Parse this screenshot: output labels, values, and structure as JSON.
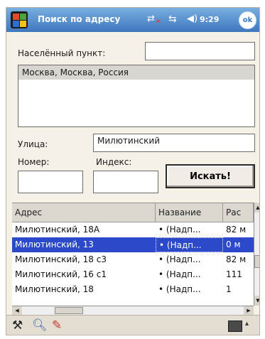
{
  "window": {
    "title": "Поиск по адресу",
    "time": "9:29",
    "ok_label": "ok"
  },
  "form": {
    "locality_label": "Населённый пункт:",
    "locality_value": "",
    "locality_results": [
      "Москва, Москва, Россия"
    ],
    "street_label": "Улица:",
    "street_value": "Милютинский",
    "number_label": "Номер:",
    "number_value": "",
    "index_label": "Индекс:",
    "index_value": "",
    "search_button": "Искать!"
  },
  "results": {
    "columns": [
      "Адрес",
      "Название",
      "Рас"
    ],
    "rows": [
      {
        "address": "Милютинский, 18А",
        "name": "• (Надп...",
        "dist": "82 м"
      },
      {
        "address": "Милютинский, 13",
        "name": "• (Надп...",
        "dist": "0 м",
        "selected": true
      },
      {
        "address": "Милютинский, 18 с3",
        "name": "• (Надп...",
        "dist": "82 м"
      },
      {
        "address": "Милютинский, 16 с1",
        "name": "• (Надп...",
        "dist": "111"
      },
      {
        "address": "Милютинский, 18",
        "name": "• (Надп...",
        "dist": "1"
      }
    ]
  },
  "icons": {
    "start": "windows-start-icon",
    "network": "network-icon",
    "sync": "sync-icon",
    "volume": "volume-icon",
    "tools": "tools-icon",
    "search": "magnifier-icon",
    "pin": "map-pin-icon",
    "keyboard": "keyboard-icon"
  },
  "colors": {
    "titlebar": "#3d77bd",
    "selection": "#2b49c9",
    "background": "#f6f1e6"
  }
}
